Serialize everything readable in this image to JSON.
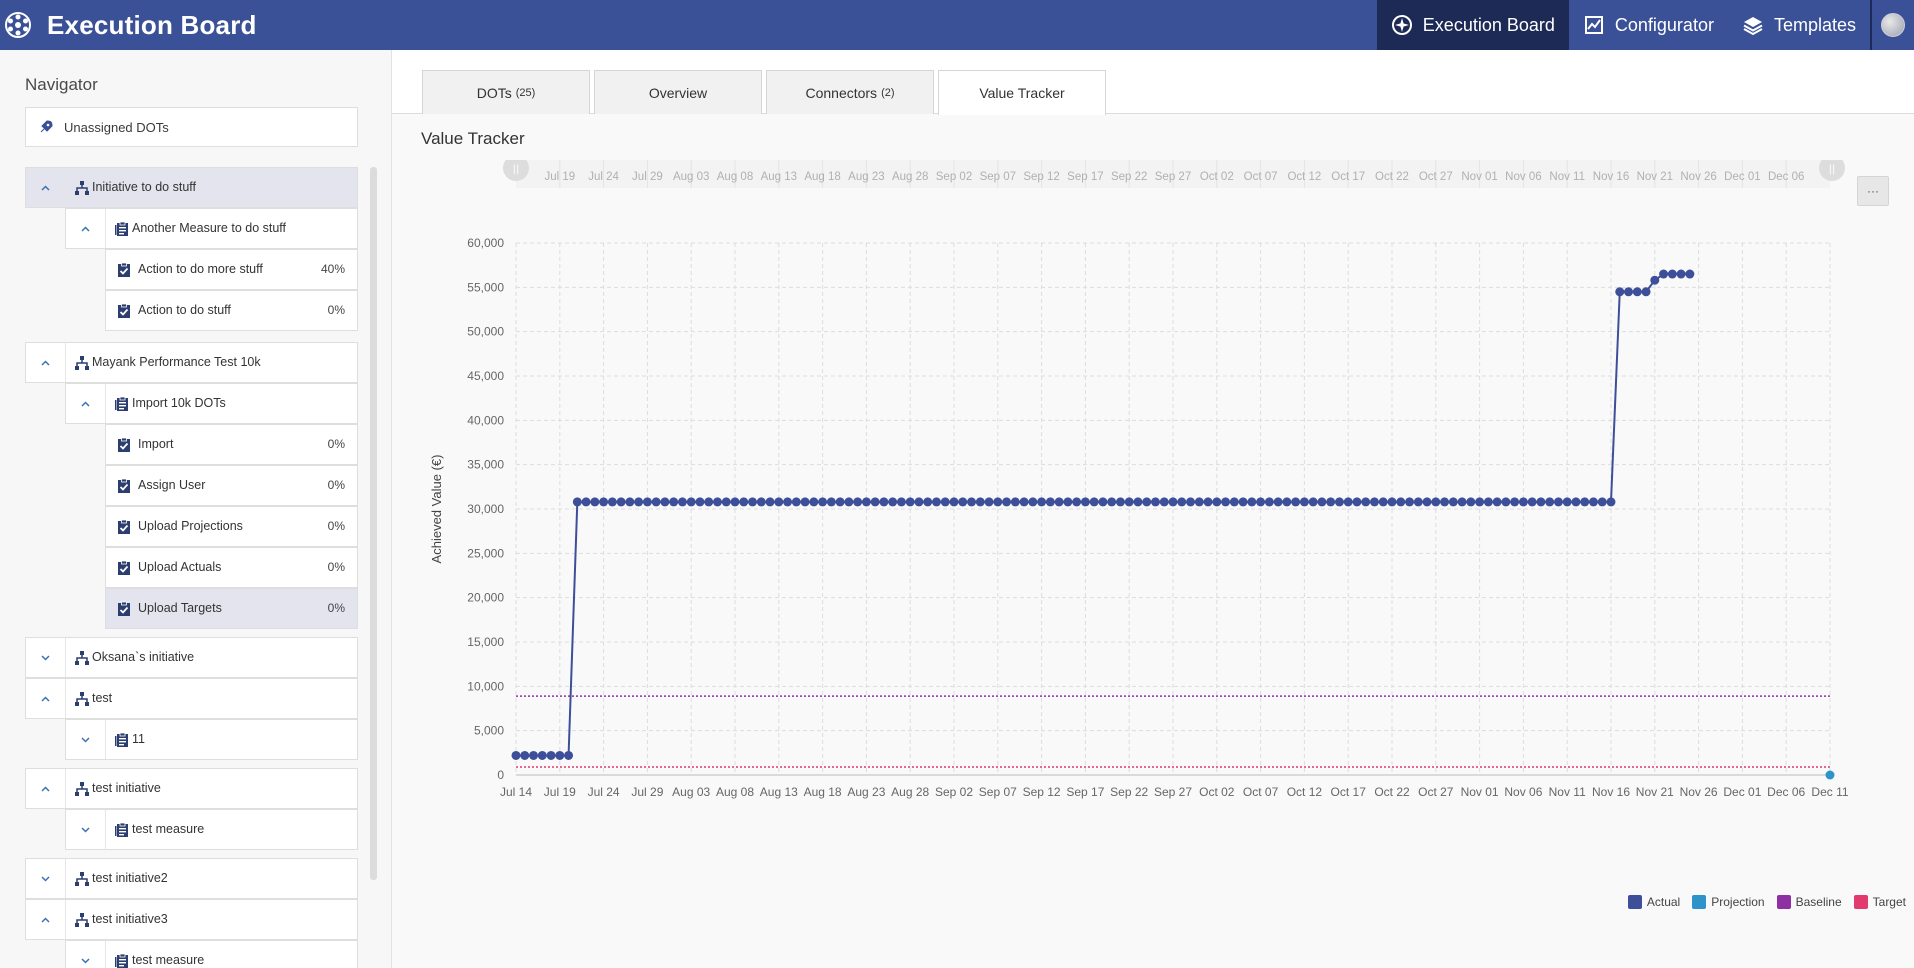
{
  "app": {
    "title": "Execution Board"
  },
  "topnav": [
    {
      "label": "Execution Board",
      "icon": "compass-icon",
      "active": true
    },
    {
      "label": "Configurator",
      "icon": "chart-icon",
      "active": false
    },
    {
      "label": "Templates",
      "icon": "layers-icon",
      "active": false
    }
  ],
  "sidebar": {
    "heading": "Navigator",
    "unassigned_label": "Unassigned DOTs",
    "rows": [
      {
        "level": 0,
        "label": "Initiative to do stuff",
        "icon": "hierarchy-icon",
        "chevron": "up",
        "pct": "",
        "selected": true
      },
      {
        "level": 1,
        "label": "Another Measure to do stuff",
        "icon": "clipboard-list-icon",
        "chevron": "up",
        "pct": "",
        "selected": false
      },
      {
        "level": 2,
        "label": "Action to do more stuff",
        "icon": "clipboard-check-icon",
        "chevron": "",
        "pct": "40%",
        "selected": false
      },
      {
        "level": 2,
        "label": "Action to do stuff",
        "icon": "clipboard-check-icon",
        "chevron": "",
        "pct": "0%",
        "selected": false
      },
      {
        "level": 0,
        "label": "Mayank Performance Test 10k",
        "icon": "hierarchy-icon",
        "chevron": "up",
        "pct": "",
        "selected": false
      },
      {
        "level": 1,
        "label": "Import 10k DOTs",
        "icon": "clipboard-list-icon",
        "chevron": "up",
        "pct": "",
        "selected": false
      },
      {
        "level": 2,
        "label": "Import",
        "icon": "clipboard-check-icon",
        "chevron": "",
        "pct": "0%",
        "selected": false
      },
      {
        "level": 2,
        "label": "Assign User",
        "icon": "clipboard-check-icon",
        "chevron": "",
        "pct": "0%",
        "selected": false
      },
      {
        "level": 2,
        "label": "Upload Projections",
        "icon": "clipboard-check-icon",
        "chevron": "",
        "pct": "0%",
        "selected": false
      },
      {
        "level": 2,
        "label": "Upload Actuals",
        "icon": "clipboard-check-icon",
        "chevron": "",
        "pct": "0%",
        "selected": false
      },
      {
        "level": 2,
        "label": "Upload Targets",
        "icon": "clipboard-check-icon",
        "chevron": "",
        "pct": "0%",
        "selected": true
      },
      {
        "level": 0,
        "label": "Oksana`s initiative",
        "icon": "hierarchy-icon",
        "chevron": "down",
        "pct": "",
        "selected": false
      },
      {
        "level": 0,
        "label": "test",
        "icon": "hierarchy-icon",
        "chevron": "up",
        "pct": "",
        "selected": false
      },
      {
        "level": 1,
        "label": "11",
        "icon": "clipboard-list-icon",
        "chevron": "down",
        "pct": "",
        "selected": false
      },
      {
        "level": 0,
        "label": "test initiative",
        "icon": "hierarchy-icon",
        "chevron": "up",
        "pct": "",
        "selected": false
      },
      {
        "level": 1,
        "label": "test measure",
        "icon": "clipboard-list-icon",
        "chevron": "down",
        "pct": "",
        "selected": false
      },
      {
        "level": 0,
        "label": "test initiative2",
        "icon": "hierarchy-icon",
        "chevron": "down",
        "pct": "",
        "selected": false
      },
      {
        "level": 0,
        "label": "test initiative3",
        "icon": "hierarchy-icon",
        "chevron": "up",
        "pct": "",
        "selected": false
      },
      {
        "level": 1,
        "label": "test measure",
        "icon": "clipboard-list-icon",
        "chevron": "down",
        "pct": "",
        "selected": false
      }
    ]
  },
  "tabs": [
    {
      "label": "DOTs",
      "count": "(25)",
      "active": false
    },
    {
      "label": "Overview",
      "count": "",
      "active": false
    },
    {
      "label": "Connectors",
      "count": "(2)",
      "active": false
    },
    {
      "label": "Value Tracker",
      "count": "",
      "active": true
    }
  ],
  "main": {
    "section_title": "Value Tracker",
    "menu_button": "···"
  },
  "colors": {
    "actual": "#3d4f99",
    "projection": "#2e93c8",
    "baseline": "#8e2fa3",
    "target": "#e03a6e",
    "brand": "#3a5197"
  },
  "chart_data": {
    "type": "line",
    "ylabel": "Achieved Value (€)",
    "ylim": [
      0,
      60000
    ],
    "yticks": [
      0,
      5000,
      10000,
      15000,
      20000,
      25000,
      30000,
      35000,
      40000,
      45000,
      50000,
      55000,
      60000
    ],
    "ytick_labels": [
      "0",
      "5,000",
      "10,000",
      "15,000",
      "20,000",
      "25,000",
      "30,000",
      "35,000",
      "40,000",
      "45,000",
      "50,000",
      "55,000",
      "60,000"
    ],
    "xlim": [
      "Jul 14",
      "Dec 11"
    ],
    "xtick_labels": [
      "Jul 14",
      "Jul 19",
      "Jul 24",
      "Jul 29",
      "Aug 03",
      "Aug 08",
      "Aug 13",
      "Aug 18",
      "Aug 23",
      "Aug 28",
      "Sep 02",
      "Sep 07",
      "Sep 12",
      "Sep 17",
      "Sep 22",
      "Sep 27",
      "Oct 02",
      "Oct 07",
      "Oct 12",
      "Oct 17",
      "Oct 22",
      "Oct 27",
      "Nov 01",
      "Nov 06",
      "Nov 11",
      "Nov 16",
      "Nov 21",
      "Nov 26",
      "Dec 01",
      "Dec 06",
      "Dec 11"
    ],
    "navigator_tick_labels": [
      "Jul 19",
      "Jul 24",
      "Jul 29",
      "Aug 03",
      "Aug 08",
      "Aug 13",
      "Aug 18",
      "Aug 23",
      "Aug 28",
      "Sep 02",
      "Sep 07",
      "Sep 12",
      "Sep 17",
      "Sep 22",
      "Sep 27",
      "Oct 02",
      "Oct 07",
      "Oct 12",
      "Oct 17",
      "Oct 22",
      "Oct 27",
      "Nov 01",
      "Nov 06",
      "Nov 11",
      "Nov 16",
      "Nov 21",
      "Nov 26",
      "Dec 01",
      "Dec 06"
    ],
    "grid": true,
    "legend_position": "bottom-right",
    "series": [
      {
        "name": "Actual",
        "segments": [
          {
            "from_day": 0,
            "to_day": 6,
            "value": 2200
          },
          {
            "from_day": 7,
            "to_day": 125,
            "value": 30800
          },
          {
            "from_day": 126,
            "to_day": 129,
            "value": 54500
          },
          {
            "from_day": 130,
            "to_day": 130,
            "value": 55800
          },
          {
            "from_day": 131,
            "to_day": 134,
            "value": 56500
          }
        ]
      },
      {
        "name": "Projection",
        "points": [
          {
            "day": 150,
            "value": 0
          }
        ]
      },
      {
        "name": "Baseline",
        "constant": 8900
      },
      {
        "name": "Target",
        "constant": 900
      }
    ]
  }
}
